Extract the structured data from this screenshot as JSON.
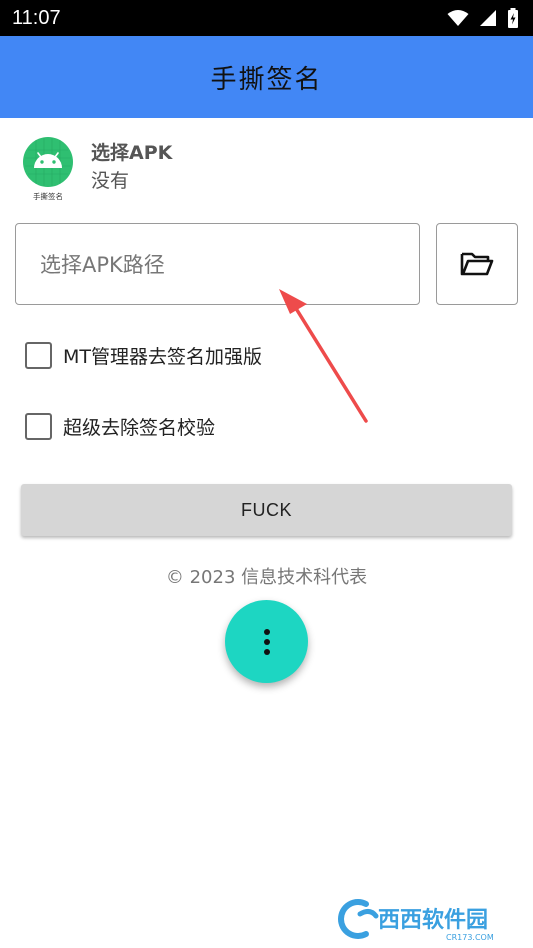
{
  "status_bar": {
    "time": "11:07",
    "icons": [
      "wifi-icon",
      "signal-icon",
      "battery-charging-icon"
    ]
  },
  "app_bar": {
    "title": "手撕签名"
  },
  "apk_info": {
    "icon_caption": "手撕签名",
    "name": "选择APK",
    "status": "没有"
  },
  "path_input": {
    "placeholder": "选择APK路径",
    "button_icon": "folder-open-icon"
  },
  "options": [
    {
      "label": "MT管理器去签名加强版",
      "checked": false
    },
    {
      "label": "超级去除签名校验",
      "checked": false
    }
  ],
  "action_button": {
    "label": "FUCK"
  },
  "footer": {
    "copyright": "© 2023 信息技术科代表"
  },
  "fab": {
    "icon": "more-vertical-icon"
  },
  "watermark": {
    "text": "西西软件园",
    "sub": "CR173.COM"
  },
  "colors": {
    "app_bar": "#4287f5",
    "fab": "#1dd6c2",
    "arrow": "#ee4b4b",
    "android_icon_bg": "#2fbf71"
  }
}
